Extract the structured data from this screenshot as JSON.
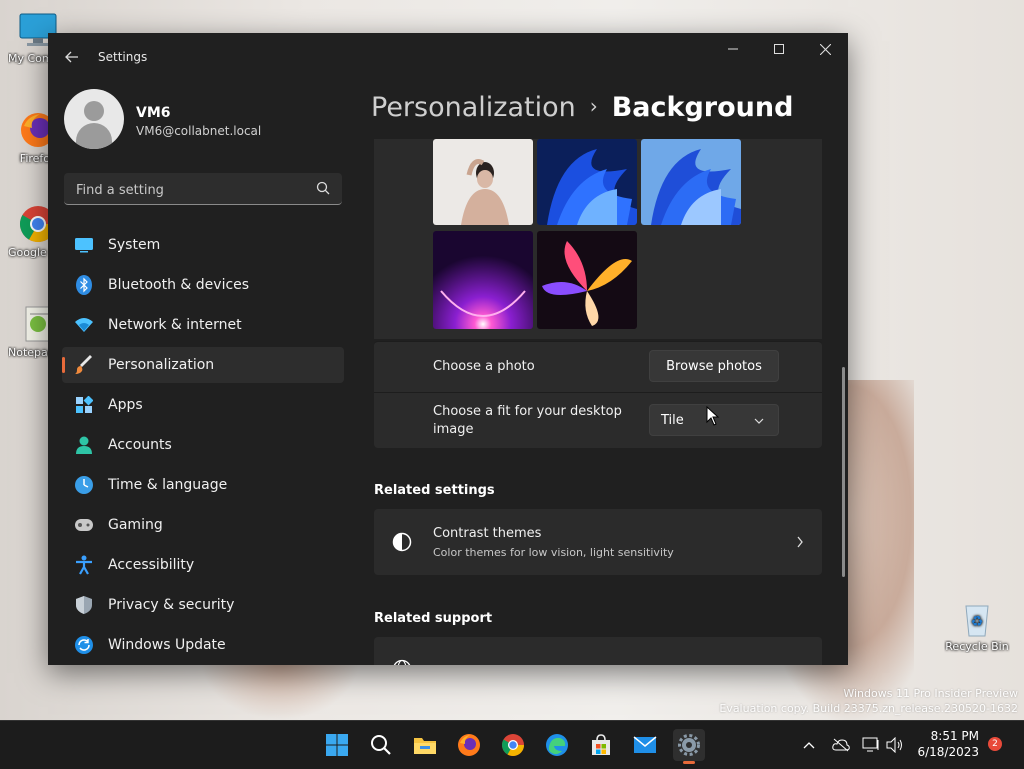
{
  "desktop": {
    "icons": [
      {
        "label": "My Computer",
        "icon": "computer-icon"
      },
      {
        "label": "Firefox",
        "icon": "firefox-icon"
      },
      {
        "label": "Google Chrome",
        "icon": "chrome-icon"
      },
      {
        "label": "Notepad++",
        "icon": "notepad-icon"
      }
    ],
    "recycle_bin": {
      "label": "Recycle Bin",
      "icon": "recycle-bin-icon"
    },
    "watermark_line1": "Windows 11 Pro Insider Preview",
    "watermark_line2": "Evaluation copy. Build 23375.zn_release.230520-1632"
  },
  "window": {
    "title": "Settings",
    "controls": {
      "minimize": "─",
      "maximize": "☐",
      "close": "✕"
    }
  },
  "user": {
    "name": "VM6",
    "email": "VM6@collabnet.local"
  },
  "search": {
    "placeholder": "Find a setting"
  },
  "nav": [
    {
      "label": "System",
      "icon": "system-icon",
      "active": false
    },
    {
      "label": "Bluetooth & devices",
      "icon": "bluetooth-icon",
      "active": false
    },
    {
      "label": "Network & internet",
      "icon": "network-icon",
      "active": false
    },
    {
      "label": "Personalization",
      "icon": "personalization-brush-icon",
      "active": true
    },
    {
      "label": "Apps",
      "icon": "apps-icon",
      "active": false
    },
    {
      "label": "Accounts",
      "icon": "accounts-icon",
      "active": false
    },
    {
      "label": "Time & language",
      "icon": "time-language-icon",
      "active": false
    },
    {
      "label": "Gaming",
      "icon": "gaming-icon",
      "active": false
    },
    {
      "label": "Accessibility",
      "icon": "accessibility-icon",
      "active": false
    },
    {
      "label": "Privacy & security",
      "icon": "shield-icon",
      "active": false
    },
    {
      "label": "Windows Update",
      "icon": "update-icon",
      "active": false
    }
  ],
  "breadcrumb": {
    "parent": "Personalization",
    "separator": "›",
    "current": "Background"
  },
  "background": {
    "recent_images": [
      "woman-photo",
      "blue-bloom-dark",
      "blue-bloom-light",
      "purple-glow",
      "colorful-flower"
    ],
    "choose_photo_label": "Choose a photo",
    "browse_button": "Browse photos",
    "choose_fit_label": "Choose a fit for your desktop image",
    "fit_value": "Tile"
  },
  "related_settings": {
    "title": "Related settings",
    "contrast": {
      "title": "Contrast themes",
      "subtitle": "Color themes for low vision, light sensitivity",
      "icon": "contrast-icon"
    }
  },
  "related_support": {
    "title": "Related support"
  },
  "taskbar": {
    "apps": [
      "start-icon",
      "search-icon",
      "file-explorer-icon",
      "firefox-icon",
      "chrome-icon",
      "edge-icon",
      "store-icon",
      "mail-icon",
      "settings-gear-icon"
    ],
    "time": "8:51 PM",
    "date": "6/18/2023",
    "notifications": "2"
  },
  "colors": {
    "accent": "#e86a3a",
    "window_bg": "#202020",
    "card_bg": "#2b2b2b"
  }
}
